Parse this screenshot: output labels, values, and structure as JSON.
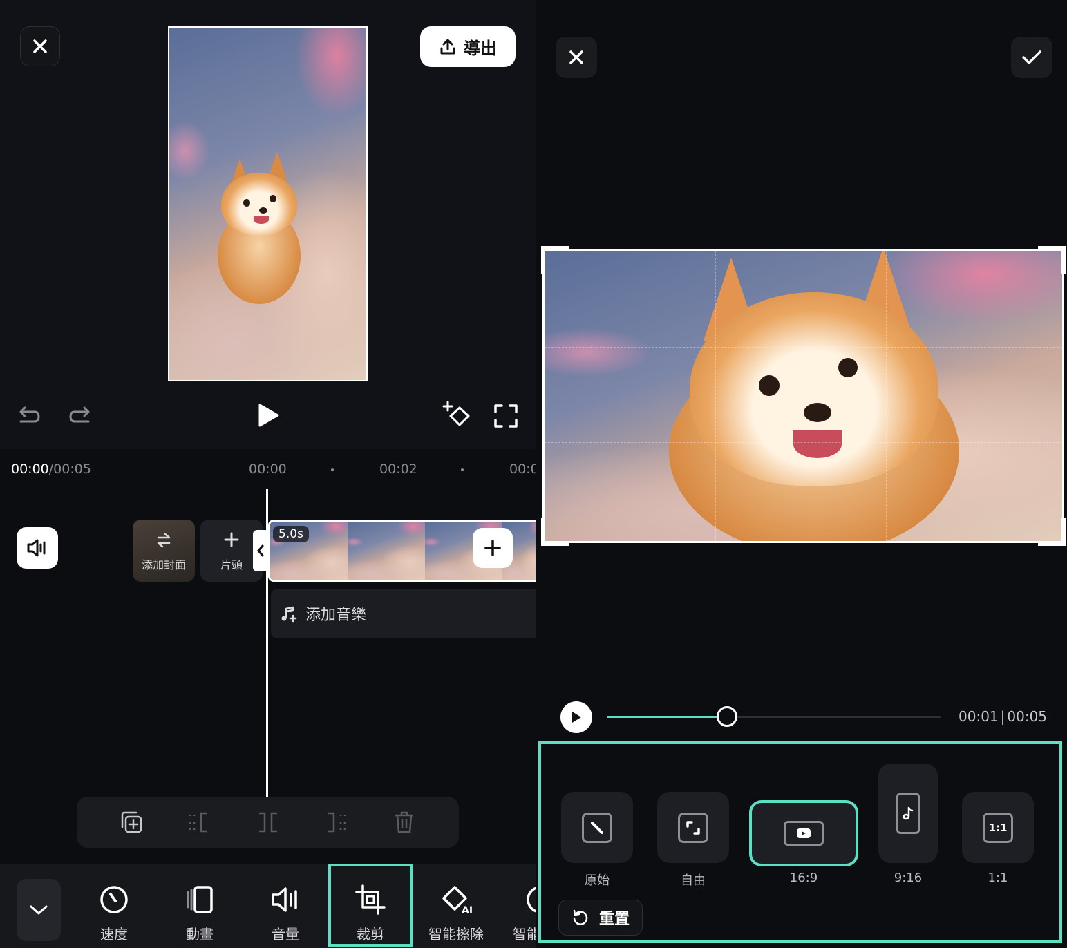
{
  "left": {
    "close_label": "✕",
    "export_label": "導出",
    "timeline": {
      "current_time": "00:00",
      "total_time": "/00:05",
      "ticks": [
        "00:00",
        "00:02",
        "00:0"
      ]
    },
    "track": {
      "add_cover_label": "添加封面",
      "intro_label": "片頭",
      "clip_duration": "5.0s",
      "add_music_label": "添加音樂"
    },
    "toolbar": {
      "items": [
        {
          "label": "速度",
          "icon": "speed-icon"
        },
        {
          "label": "動畫",
          "icon": "animation-icon"
        },
        {
          "label": "音量",
          "icon": "volume-icon"
        },
        {
          "label": "裁剪",
          "icon": "crop-icon",
          "selected": true
        },
        {
          "label": "智能擦除",
          "icon": "ai-erase-icon"
        },
        {
          "label": "智能",
          "icon": "smart-icon"
        }
      ]
    }
  },
  "right": {
    "close_label": "✕",
    "confirm_label": "✓",
    "player": {
      "current": "00:01",
      "separator": "|",
      "total": "00:05",
      "progress": 0.36
    },
    "ratios": [
      {
        "label": "原始",
        "icon": "original-icon"
      },
      {
        "label": "自由",
        "icon": "free-icon"
      },
      {
        "label": "16:9",
        "icon": "youtube-icon",
        "selected": true
      },
      {
        "label": "9:16",
        "icon": "tiktok-icon"
      },
      {
        "label": "1:1",
        "icon": "square-icon"
      }
    ],
    "reset_label": "重置"
  },
  "colors": {
    "accent": "#5ce0c4",
    "panel_bg": "#111217",
    "tile_bg": "#1d1f24"
  }
}
